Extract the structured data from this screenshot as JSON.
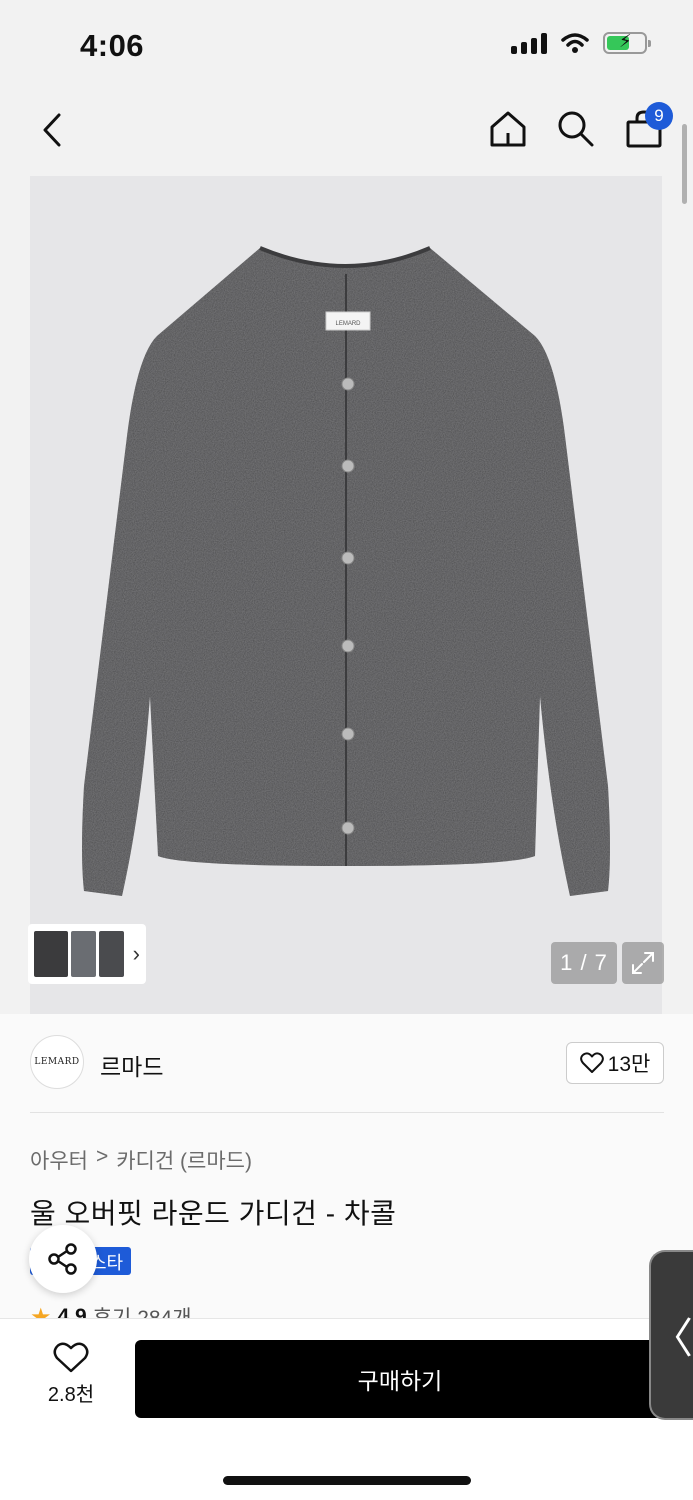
{
  "status_bar": {
    "time": "4:06",
    "icons": [
      "signal-icon",
      "wifi-icon",
      "battery-charging-icon"
    ]
  },
  "nav": {
    "icons": [
      "back-chevron-icon",
      "home-icon",
      "search-icon",
      "shopping-bag-icon"
    ],
    "cart_count": "9"
  },
  "gallery": {
    "page_counter": "1 / 7",
    "thumb_arrow": "›",
    "product_label_text": "LEMARD",
    "thumb_colors": [
      "#3b3b3d",
      "#6a6d72",
      "#4a4b4e"
    ]
  },
  "brand": {
    "logo_text": "LEMARD",
    "name": "르마드",
    "favorite_count": "13만"
  },
  "product": {
    "breadcrumb": [
      "아우터",
      "카디건 (르마드)"
    ],
    "breadcrumb_separator": ">",
    "title": "울 오버핏 라운드 가디건 - 차콜",
    "tag": "스타",
    "rating_score": "4.9",
    "review_text": "후기 284개"
  },
  "bottom_bar": {
    "like_count": "2.8천",
    "buy_label": "구매하기",
    "side_handle": "〈"
  },
  "colors": {
    "accent_blue": "#1e5bd8",
    "buy_button": "#000000",
    "sweater": "#4a4a4c"
  }
}
